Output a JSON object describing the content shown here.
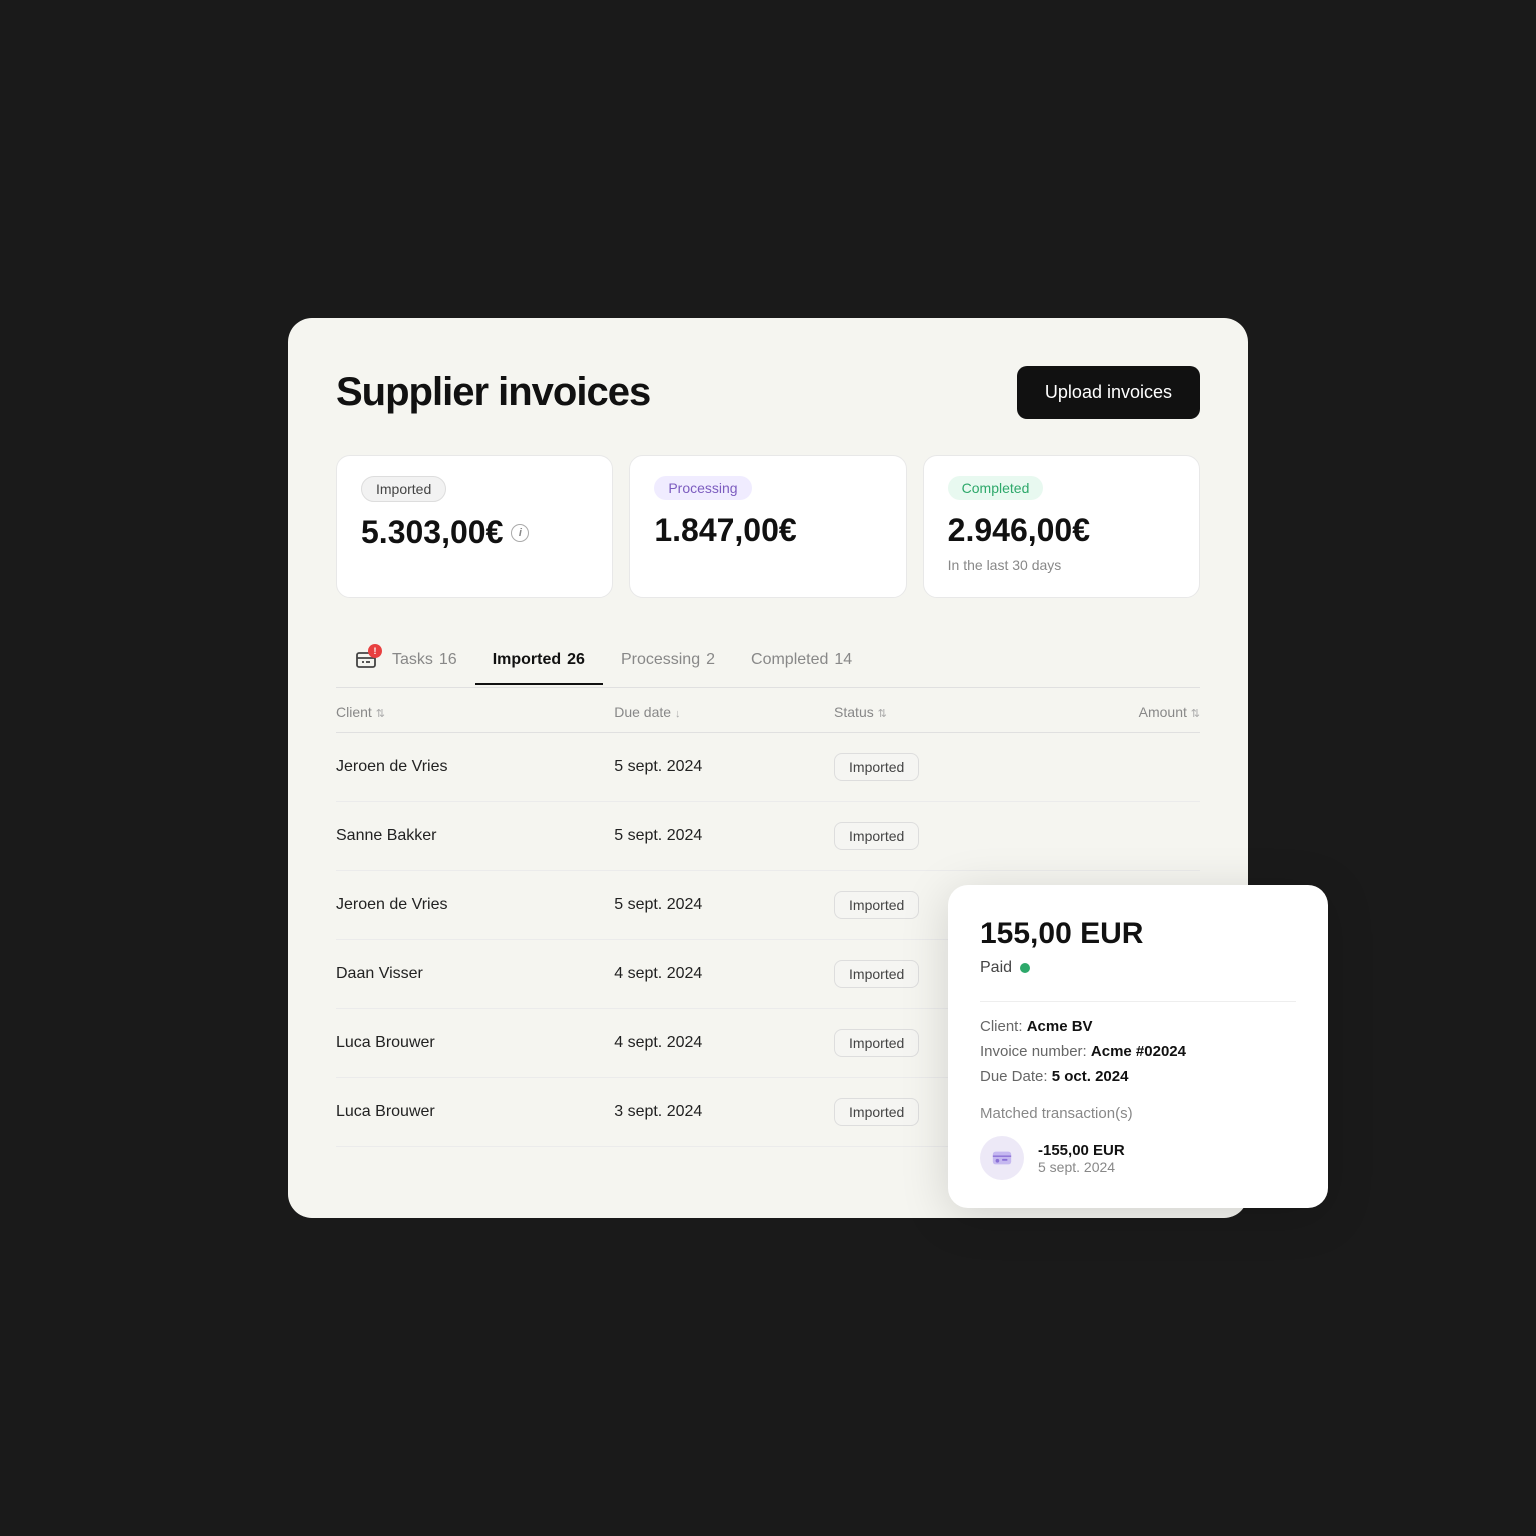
{
  "page": {
    "title": "Supplier invoices",
    "upload_button": "Upload invoices"
  },
  "summary_cards": [
    {
      "badge": "Imported",
      "badge_type": "imported",
      "amount": "5.303,00€",
      "show_info": true,
      "subtitle": ""
    },
    {
      "badge": "Processing",
      "badge_type": "processing",
      "amount": "1.847,00€",
      "show_info": false,
      "subtitle": ""
    },
    {
      "badge": "Completed",
      "badge_type": "completed",
      "amount": "2.946,00€",
      "show_info": false,
      "subtitle": "In the last 30 days"
    }
  ],
  "tabs": [
    {
      "id": "tasks",
      "label": "Tasks",
      "count": "16",
      "active": false,
      "has_icon": true
    },
    {
      "id": "imported",
      "label": "Imported",
      "count": "26",
      "active": true,
      "has_icon": false
    },
    {
      "id": "processing",
      "label": "Processing",
      "count": "2",
      "active": false,
      "has_icon": false
    },
    {
      "id": "completed",
      "label": "Completed",
      "count": "14",
      "active": false,
      "has_icon": false
    }
  ],
  "table": {
    "columns": [
      {
        "id": "client",
        "label": "Client",
        "sort": "↕"
      },
      {
        "id": "due_date",
        "label": "Due date",
        "sort": "↓"
      },
      {
        "id": "status",
        "label": "Status",
        "sort": "↕"
      },
      {
        "id": "amount",
        "label": "Amount",
        "sort": "↕",
        "align": "right"
      }
    ],
    "rows": [
      {
        "client": "Jeroen de Vries",
        "due_date": "5 sept. 2024",
        "status": "Imported",
        "amount": ""
      },
      {
        "client": "Sanne Bakker",
        "due_date": "5 sept. 2024",
        "status": "Imported",
        "amount": ""
      },
      {
        "client": "Jeroen de Vries",
        "due_date": "5 sept. 2024",
        "status": "Imported",
        "amount": ""
      },
      {
        "client": "Daan Visser",
        "due_date": "4 sept. 2024",
        "status": "Imported",
        "amount": ""
      },
      {
        "client": "Luca Brouwer",
        "due_date": "4 sept. 2024",
        "status": "Imported",
        "amount": ""
      },
      {
        "client": "Luca Brouwer",
        "due_date": "3 sept. 2024",
        "status": "Imported",
        "amount": ""
      }
    ]
  },
  "tooltip": {
    "amount": "155,00 EUR",
    "status": "Paid",
    "client_label": "Client:",
    "client_value": "Acme BV",
    "invoice_number_label": "Invoice number:",
    "invoice_number_value": "Acme #02024",
    "due_date_label": "Due Date:",
    "due_date_value": "5 oct. 2024",
    "matched_transactions_title": "Matched transaction(s)",
    "transaction_amount": "-155,00 EUR",
    "transaction_date": "5 sept. 2024"
  }
}
